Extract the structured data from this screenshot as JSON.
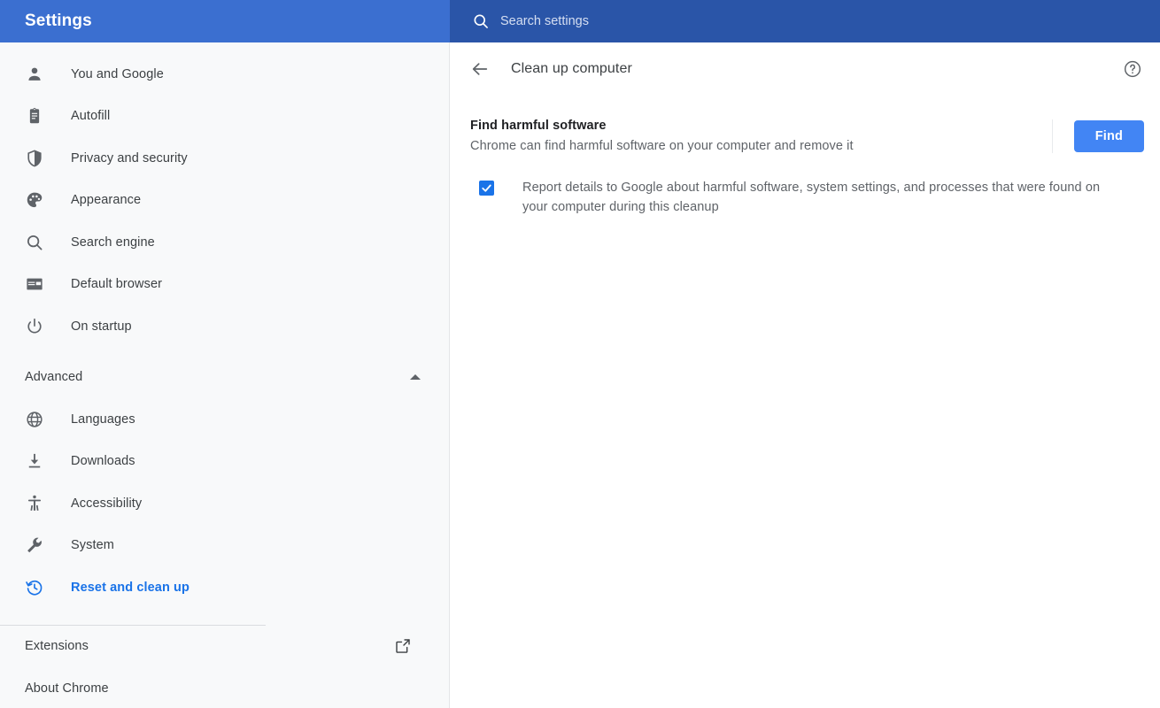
{
  "topbar": {
    "title": "Settings",
    "search_icon": "search-icon",
    "search_placeholder": "Search settings",
    "search_value": "",
    "left_bg": "#3B6FD0",
    "search_bg": "#2A55A8"
  },
  "sidebar": {
    "items": [
      {
        "label": "You and Google",
        "icon": "person-icon",
        "selected": false
      },
      {
        "label": "Autofill",
        "icon": "clipboard-icon",
        "selected": false
      },
      {
        "label": "Privacy and security",
        "icon": "shield-icon",
        "selected": false
      },
      {
        "label": "Appearance",
        "icon": "palette-icon",
        "selected": false
      },
      {
        "label": "Search engine",
        "icon": "magnifier-icon",
        "selected": false
      },
      {
        "label": "Default browser",
        "icon": "browser-window-icon",
        "selected": false
      },
      {
        "label": "On startup",
        "icon": "power-icon",
        "selected": false
      }
    ],
    "group": {
      "label": "Advanced",
      "expanded": true,
      "chevron_icon": "chevron-up-icon"
    },
    "advanced_items": [
      {
        "label": "Languages",
        "icon": "globe-icon",
        "selected": false
      },
      {
        "label": "Downloads",
        "icon": "download-icon",
        "selected": false
      },
      {
        "label": "Accessibility",
        "icon": "accessibility-icon",
        "selected": false
      },
      {
        "label": "System",
        "icon": "wrench-icon",
        "selected": false
      },
      {
        "label": "Reset and clean up",
        "icon": "history-icon",
        "selected": true
      }
    ],
    "bottom": [
      {
        "label": "Extensions",
        "icon": "external-link-icon"
      },
      {
        "label": "About Chrome",
        "icon": ""
      }
    ],
    "selected_color": "#1a73e8",
    "background": "#F8F9FA"
  },
  "main": {
    "back_icon": "back-arrow-icon",
    "page_title": "Clean up computer",
    "help_icon": "help-circle-icon",
    "section": {
      "title": "Find harmful software",
      "subtitle": "Chrome can find harmful software on your computer and remove it",
      "button_label": "Find",
      "button_color": "#4285F4"
    },
    "checkbox": {
      "checked": true,
      "label": "Report details to Google about harmful software, system settings, and processes that were found on your computer during this cleanup",
      "color": "#1a73e8"
    }
  }
}
